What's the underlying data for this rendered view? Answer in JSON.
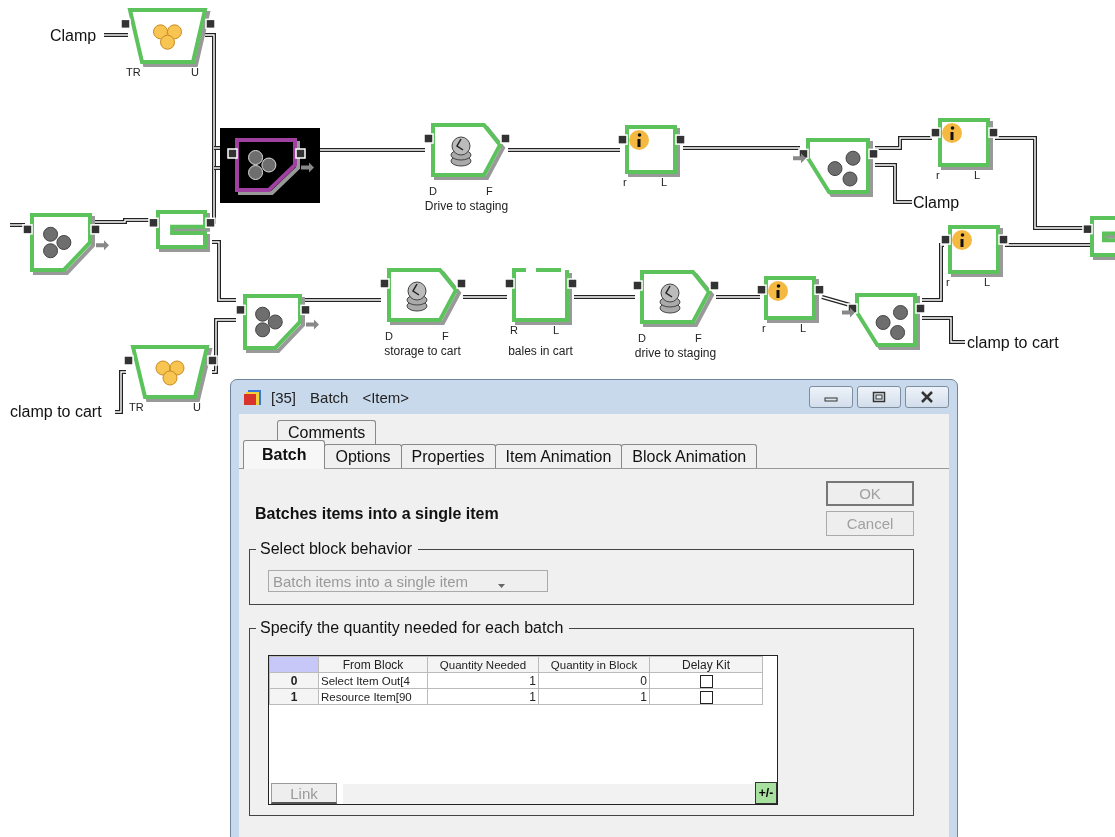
{
  "diagram": {
    "blocks": [
      {
        "kind": "resource",
        "selected": false,
        "ports": [
          "TR",
          "U"
        ]
      },
      {
        "kind": "batch",
        "selected": true
      },
      {
        "kind": "activity",
        "selected": false,
        "ports": [
          "D",
          "F"
        ],
        "caption": "Drive to staging"
      },
      {
        "kind": "info",
        "selected": false,
        "ports": [
          "r",
          "L"
        ]
      },
      {
        "kind": "select_out",
        "selected": false
      },
      {
        "kind": "info",
        "selected": false,
        "ports": [
          "r",
          "L"
        ]
      },
      {
        "kind": "batch",
        "selected": false
      },
      {
        "kind": "select_in",
        "selected": false
      },
      {
        "kind": "select_in",
        "selected": false
      },
      {
        "kind": "info",
        "selected": false,
        "ports": [
          "r",
          "L"
        ]
      },
      {
        "kind": "batch",
        "selected": false
      },
      {
        "kind": "activity",
        "selected": false,
        "ports": [
          "D",
          "F"
        ],
        "caption": "storage to cart"
      },
      {
        "kind": "queue",
        "selected": false,
        "ports": [
          "R",
          "L"
        ],
        "caption": "bales in cart"
      },
      {
        "kind": "activity",
        "selected": false,
        "ports": [
          "D",
          "F"
        ],
        "caption": "drive to staging"
      },
      {
        "kind": "info",
        "selected": false,
        "ports": [
          "r",
          "L"
        ]
      },
      {
        "kind": "select_out",
        "selected": false
      },
      {
        "kind": "resource",
        "selected": false,
        "ports": [
          "TR",
          "U"
        ]
      }
    ],
    "labels": [
      {
        "text": "Clamp"
      },
      {
        "text": "Clamp"
      },
      {
        "text": "clamp to cart"
      },
      {
        "text": "clamp to cart"
      }
    ]
  },
  "dialog": {
    "title_parts": [
      "[35]",
      "Batch",
      "<Item>"
    ],
    "tab_rows": [
      [
        {
          "label": "Comments",
          "selected": false
        }
      ],
      [
        {
          "label": "Batch",
          "selected": true
        },
        {
          "label": "Options",
          "selected": false
        },
        {
          "label": "Properties",
          "selected": false
        },
        {
          "label": "Item Animation",
          "selected": false
        },
        {
          "label": "Block Animation",
          "selected": false
        }
      ]
    ],
    "heading": "Batches items into a single item",
    "buttons": [
      {
        "label": "OK",
        "disabled": true
      },
      {
        "label": "Cancel",
        "disabled": true
      }
    ],
    "behavior_group": {
      "legend": "Select block behavior",
      "dropdown": {
        "value": "Batch items into a single item",
        "disabled": true
      }
    },
    "quantity_group": {
      "legend": "Specify the quantity needed for each batch",
      "table": {
        "columns": [
          "From Block",
          "Quantity Needed",
          "Quantity in Block",
          "Delay Kit"
        ],
        "rows": [
          {
            "index": "0",
            "from_block": "Select Item Out[4",
            "quantity_needed": "1",
            "quantity_in_block": "0",
            "delay_kit": false
          },
          {
            "index": "1",
            "from_block": "Resource Item[90",
            "quantity_needed": "1",
            "quantity_in_block": "1",
            "delay_kit": false
          }
        ]
      },
      "link_button": {
        "label": "Link",
        "disabled": true
      },
      "add_remove_button": "+/-"
    }
  }
}
